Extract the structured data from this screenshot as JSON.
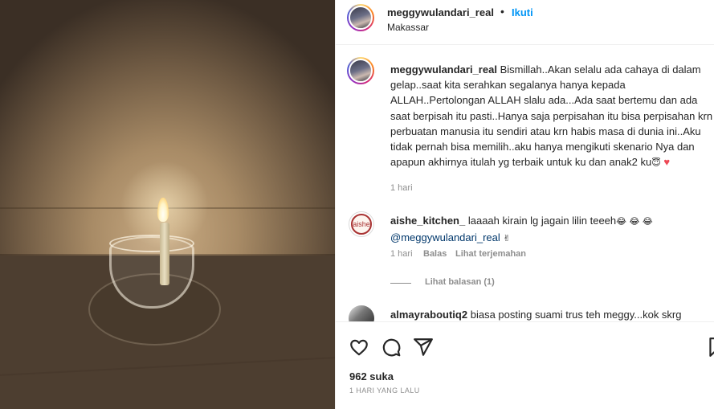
{
  "post_image": {
    "icon": "candle-photo",
    "alt_subject": "candle in glass bowl"
  },
  "header": {
    "username": "meggywulandari_real",
    "separator": "•",
    "follow_label": "Ikuti",
    "location": "Makassar"
  },
  "caption": {
    "username": "meggywulandari_real",
    "text": "Bismillah..Akan selalu ada cahaya di dalam gelap..saat kita serahkan segalanya hanya kepada ALLAH..Pertolongan ALLAH slalu ada...Ada saat bertemu dan ada saat berpisah itu pasti..Hanya saja perpisahan itu bisa perpisahan krn perbuatan manusia itu sendiri atau krn habis masa di dunia ini..Aku tidak pernah bisa memilih..aku hanya mengikuti skenario Nya dan apapun akhirnya itulah yg terbaik untuk ku dan anak2 ku",
    "emoji_1": "😇",
    "emoji_2": "♥",
    "time": "1 hari"
  },
  "comments": [
    {
      "username": "aishe_kitchen_",
      "text": "laaaah kirain lg jagain lilin teeeh",
      "emojis": "😂 😂 😂",
      "mention": "@meggywulandari_real",
      "trailing_emoji": "✌",
      "avatar_label": "aishe",
      "time": "1 hari",
      "reply_label": "Balas",
      "translate_label": "Lihat terjemahan",
      "view_replies_label": "Lihat balasan (1)"
    },
    {
      "username": "almayraboutiq2",
      "text": "biasa posting suami trus teh meggy...kok skrg"
    }
  ],
  "actions": {
    "icons": [
      "heart-icon",
      "comment-icon",
      "share-icon",
      "bookmark-icon"
    ],
    "likes": "962 suka",
    "date": "1 HARI YANG LALU"
  },
  "colors": {
    "accent_link": "#0095f6",
    "mention": "#00376b",
    "muted": "#8e8e8e",
    "heart": "#ed4956"
  }
}
